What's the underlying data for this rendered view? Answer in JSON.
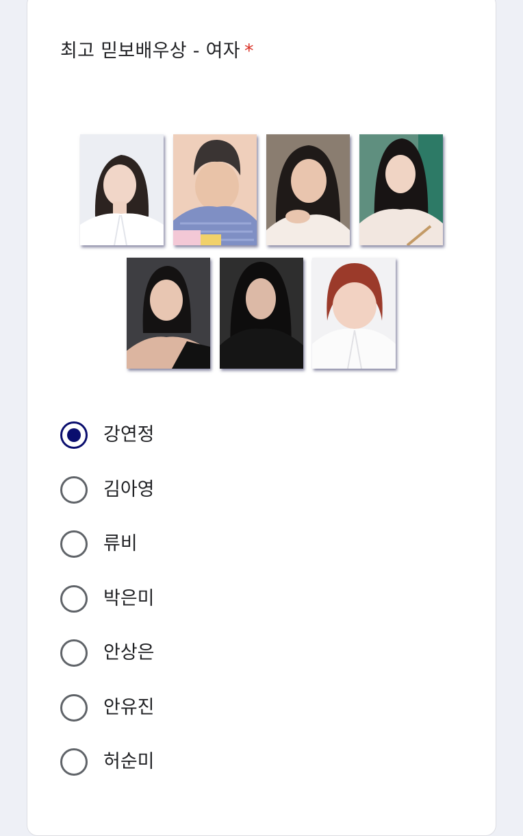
{
  "question": {
    "title": "최고 믿보배우상 - 여자",
    "required_mark": "*"
  },
  "options": [
    {
      "label": "강연정",
      "selected": true
    },
    {
      "label": "김아영",
      "selected": false
    },
    {
      "label": "류비",
      "selected": false
    },
    {
      "label": "박은미",
      "selected": false
    },
    {
      "label": "안상은",
      "selected": false
    },
    {
      "label": "안유진",
      "selected": false
    },
    {
      "label": "허순미",
      "selected": false
    }
  ],
  "colors": {
    "accent": "#0a0e6e",
    "required": "#d93025",
    "radio_unselected": "#5f6368"
  }
}
